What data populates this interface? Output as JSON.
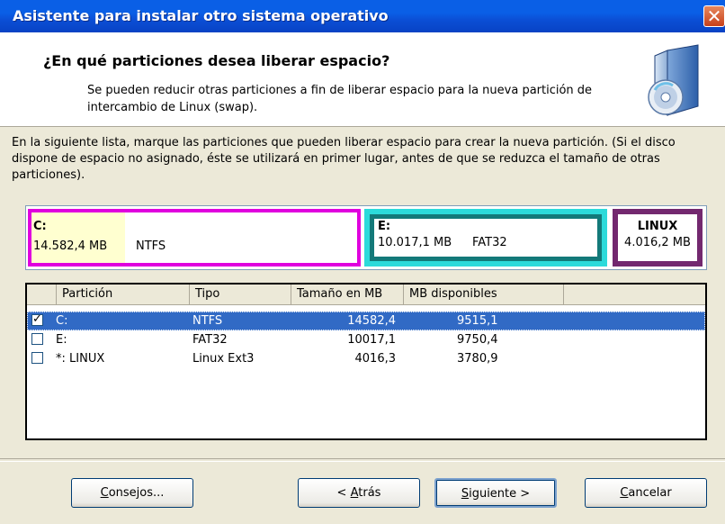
{
  "window": {
    "title": "Asistente para instalar otro sistema operativo",
    "close_glyph": "✕"
  },
  "header": {
    "heading": "¿En qué particiones desea liberar espacio?",
    "subtext": "Se pueden reducir otras particiones a fin de liberar espacio para la nueva partición de intercambio de Linux (swap).",
    "icon": "install-disc-icon"
  },
  "instructions": "En la siguiente lista, marque las particiones que pueden liberar espacio para crear la nueva partición. (Si el disco dispone de espacio no asignado, éste se utilizará en primer lugar, antes de que se reduzca el tamaño de otras particiones).",
  "disk_map": {
    "partitions": [
      {
        "label": "C:",
        "size": "14.582,4 MB",
        "fs": "NTFS",
        "color": "#E000DE"
      },
      {
        "label": "E:",
        "size": "10.017,1 MB",
        "fs": "FAT32",
        "color": "#2CDADA"
      },
      {
        "label": "LINUX",
        "size": "4.016,2 MB",
        "fs": "",
        "color": "#73286F"
      }
    ]
  },
  "list": {
    "columns": [
      "Partición",
      "Tipo",
      "Tamaño en MB",
      "MB disponibles"
    ],
    "rows": [
      {
        "checked": true,
        "name": "C:",
        "type": "NTFS",
        "size": "14582,4",
        "available": "9515,1"
      },
      {
        "checked": false,
        "name": "E:",
        "type": "FAT32",
        "size": "10017,1",
        "available": "9750,4"
      },
      {
        "checked": false,
        "name": "*: LINUX",
        "type": "Linux Ext3",
        "size": "4016,3",
        "available": "3780,9"
      }
    ]
  },
  "buttons": {
    "tips": {
      "mnemonic": "C",
      "rest": "onsejos..."
    },
    "back": {
      "prefix": "< ",
      "mnemonic": "A",
      "rest": "trás"
    },
    "next": {
      "mnemonic": "S",
      "rest": "iguiente >"
    },
    "cancel": {
      "mnemonic": "C",
      "rest": "ancelar"
    }
  },
  "colors": {
    "title_bar": "#0A5FE6",
    "selection": "#316AC5"
  }
}
